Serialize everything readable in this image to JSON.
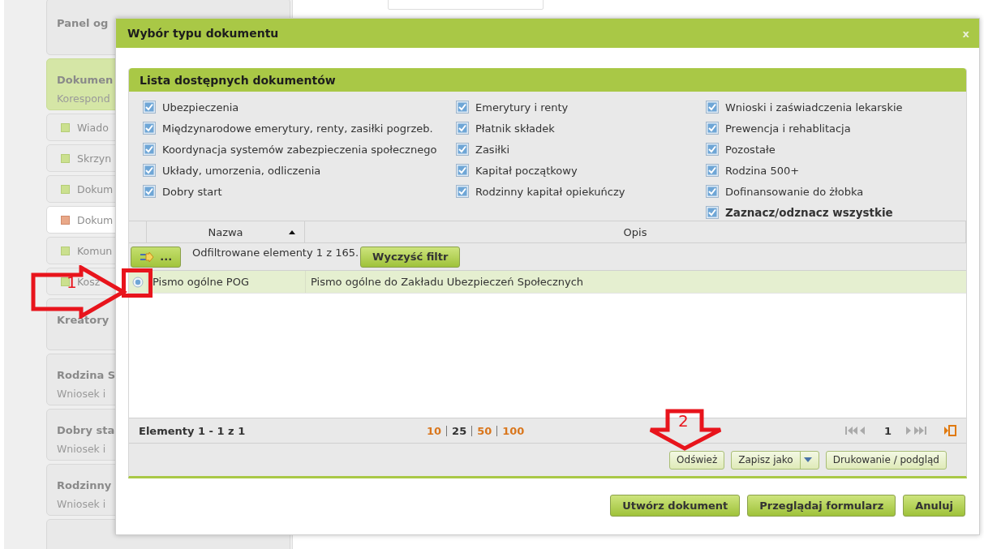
{
  "sidebar": {
    "items": [
      {
        "kind": "section",
        "title": "Panel og",
        "selected": false
      },
      {
        "kind": "section",
        "title": "Dokumen",
        "subtitle": "Korespond",
        "selected": true
      },
      {
        "kind": "link",
        "label": "Wiado",
        "selected": false
      },
      {
        "kind": "link",
        "label": "Skrzyn",
        "selected": false
      },
      {
        "kind": "link",
        "label": "Dokum",
        "selected": false
      },
      {
        "kind": "link",
        "label": "Dokum",
        "selected": true
      },
      {
        "kind": "link",
        "label": "Komun",
        "selected": false
      },
      {
        "kind": "link",
        "label": "Kosz",
        "selected": false
      },
      {
        "kind": "section",
        "title": "Kreatory",
        "selected": false
      },
      {
        "kind": "section",
        "title": "Rodzina S",
        "subtitle": "Wniosek i",
        "selected": false
      },
      {
        "kind": "section",
        "title": "Dobry sta",
        "subtitle": "Wniosek i",
        "selected": false
      },
      {
        "kind": "section",
        "title": "Rodzinny",
        "subtitle": "Wniosek i",
        "selected": false
      },
      {
        "kind": "blank",
        "selected": false
      }
    ]
  },
  "dialog": {
    "title": "Wybór typu dokumentu",
    "close": "x",
    "panel": {
      "title": "Lista dostępnych dokumentów",
      "columns": [
        [
          {
            "kind": "category",
            "label": "Ubezpieczenia",
            "checked": true
          },
          {
            "kind": "category",
            "label": "Międzynarodowe emerytury, renty, zasiłki pogrzeb.",
            "checked": true
          },
          {
            "kind": "category",
            "label": "Koordynacja systemów zabezpieczenia społecznego",
            "checked": true
          },
          {
            "kind": "category",
            "label": "Układy, umorzenia, odliczenia",
            "checked": true
          },
          {
            "kind": "category",
            "label": "Dobry start",
            "checked": true
          }
        ],
        [
          {
            "kind": "category",
            "label": "Emerytury i renty",
            "checked": true
          },
          {
            "kind": "category",
            "label": "Płatnik składek",
            "checked": true
          },
          {
            "kind": "category",
            "label": "Zasiłki",
            "checked": true
          },
          {
            "kind": "category",
            "label": "Kapitał początkowy",
            "checked": true
          },
          {
            "kind": "category",
            "label": "Rodzinny kapitał opiekuńczy",
            "checked": true
          }
        ],
        [
          {
            "kind": "category",
            "label": "Wnioski i zaświadczenia lekarskie",
            "checked": true
          },
          {
            "kind": "category",
            "label": "Prewencja i rehablitacja",
            "checked": true
          },
          {
            "kind": "category",
            "label": "Pozostałe",
            "checked": true
          },
          {
            "kind": "category",
            "label": "Rodzina 500+",
            "checked": true
          },
          {
            "kind": "category",
            "label": "Dofinansowanie do żłobka",
            "checked": true
          },
          {
            "kind": "toggle_all",
            "label": "Zaznacz/odznacz wszystkie",
            "checked": true
          }
        ]
      ]
    },
    "grid": {
      "columns": [
        {
          "label": "Nazwa",
          "sorted": true
        },
        {
          "label": "Opis",
          "sorted": false
        }
      ],
      "filter": {
        "button": "...",
        "text": "Odfiltrowane elementy 1 z 165.",
        "clear": "Wyczyść filtr"
      },
      "rows": [
        {
          "cells": [
            "Pismo ogólne POG",
            "Pismo ogólne do Zakładu Ubezpieczeń Społecznych"
          ],
          "selected": true
        }
      ],
      "pager": {
        "summary": "Elementy 1 - 1 z 1",
        "sizes": [
          {
            "label": "10",
            "selected": false
          },
          {
            "label": "25",
            "selected": true
          },
          {
            "label": "50",
            "selected": false
          },
          {
            "label": "100",
            "selected": false
          }
        ],
        "page": "1"
      },
      "toolbar": [
        {
          "label": "Odśwież",
          "dropdown": false
        },
        {
          "label": "Zapisz jako",
          "dropdown": true
        },
        {
          "label": "Drukowanie / podgląd",
          "dropdown": false
        }
      ]
    },
    "buttons": [
      "Utwórz dokument",
      "Przeglądaj formularz",
      "Anuluj"
    ]
  },
  "annotations": [
    {
      "label": "1",
      "kind": "right_arrow"
    },
    {
      "label": "2",
      "kind": "down_arrow"
    }
  ]
}
